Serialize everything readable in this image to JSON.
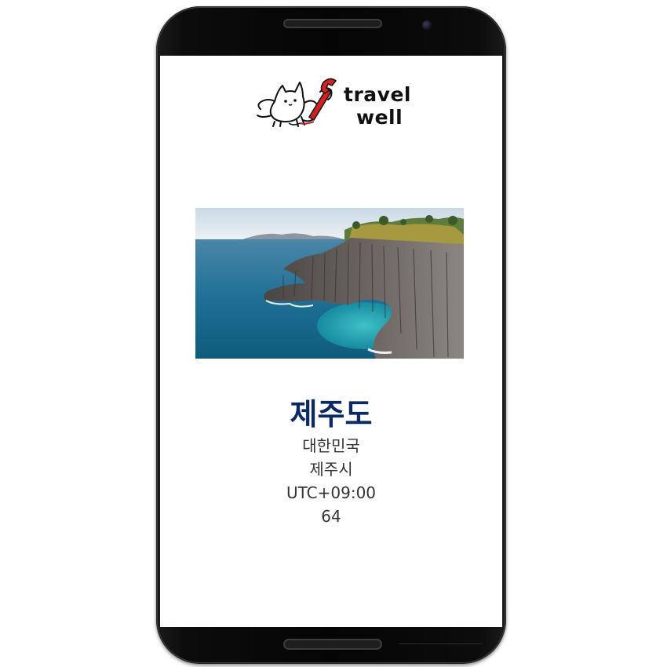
{
  "app": {
    "logo_text_line1": "travel",
    "logo_text_line2": "well",
    "logo_icon": "cat-with-wrench-icon"
  },
  "destination": {
    "name": "제주도",
    "country": "대한민국",
    "city": "제주시",
    "timezone": "UTC+09:00",
    "number": "64",
    "image": "jeju-coastal-cliffs-photo"
  },
  "colors": {
    "title": "#0b2a63",
    "text": "#333333",
    "phone_body": "#0a0a0a",
    "logo_accent": "#d42020"
  }
}
